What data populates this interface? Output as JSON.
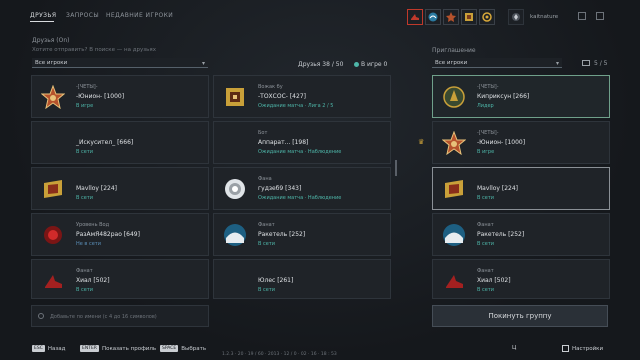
{
  "tabs": [
    {
      "label": "ДРУЗЬЯ"
    },
    {
      "label": "ЗАПРОСЫ"
    },
    {
      "label": "НЕДАВНИЕ ИГРОКИ"
    }
  ],
  "header": {
    "username": "kaitnature"
  },
  "friends_panel": {
    "title": "Друзья (On)",
    "subtitle": "Хотите отправить? В поиске — на друзьях",
    "filter_value": "Все игроки",
    "count_label": "Друзья 38 / 50",
    "online_label": "В игре 0",
    "add_placeholder": "Добавьте по имени (с 4 до 16 символов)"
  },
  "friends": [
    {
      "l1": "-[ЧЕТЫ]-",
      "l2": "-Юнион- [1000]",
      "l3": "В игре"
    },
    {
      "l1": "Вожак бу",
      "l2": "-ТОХСОС- [427]",
      "l3": "Ожидание матча · Лига 2 / 5"
    },
    {
      "l1": "",
      "l2": "_Искусител_ [666]",
      "l3": "В сети"
    },
    {
      "l1": "Бот",
      "l2": "Аппарат... [198]",
      "l3": "Ожидание матча · Наблюдение"
    },
    {
      "l1": "",
      "l2": "Mavlloy [224]",
      "l3": "В сети"
    },
    {
      "l1": "Фана",
      "l2": "гудзеб9 [343]",
      "l3": "Ожидание матча · Наблюдение"
    },
    {
      "l1": "Уровень Вод",
      "l2": "РазАмЯ482рао [649]",
      "l3": "Не в сети"
    },
    {
      "l1": "Фанат",
      "l2": "Ракетель [252]",
      "l3": "В сети"
    },
    {
      "l1": "Фанат",
      "l2": "Хиал [502]",
      "l3": "В сети"
    },
    {
      "l1": "",
      "l2": "Юлес [261]",
      "l3": "В сети"
    }
  ],
  "party_panel": {
    "title": "Приглашение",
    "filter_value": "Все игроки",
    "count_label": "5 / 5",
    "leave_button": "Покинуть группу"
  },
  "party": [
    {
      "l1": "-[ЧЕТЫ]-",
      "l2": "Киприксун [266]",
      "l3": "Лидер"
    },
    {
      "l1": "-[ЧЕТЫ]-",
      "l2": "-Юнион- [1000]",
      "l3": "В игре"
    },
    {
      "l1": "",
      "l2": "Mavlloy [224]",
      "l3": "В сети"
    },
    {
      "l1": "Фанат",
      "l2": "Ракетель [252]",
      "l3": "В сети"
    },
    {
      "l1": "Фанат",
      "l2": "Хиал [502]",
      "l3": "В сети"
    }
  ],
  "hints": {
    "back": "Назад",
    "profile": "Показать профиль",
    "select": "Выбрать",
    "settings": "Настройки",
    "info": "Ц"
  },
  "keys": {
    "esc": "ESC",
    "enter": "ENTER",
    "space": "SPACE"
  },
  "status_line": "1.2.3 · 20 · 19 / 60 · 2013 · 12 / 0 · 02 · 16 · 18 : 53",
  "colors": {
    "accent_teal": "#4eb6a9",
    "highlight_border": "#6fa08a",
    "danger": "#c0392b"
  }
}
